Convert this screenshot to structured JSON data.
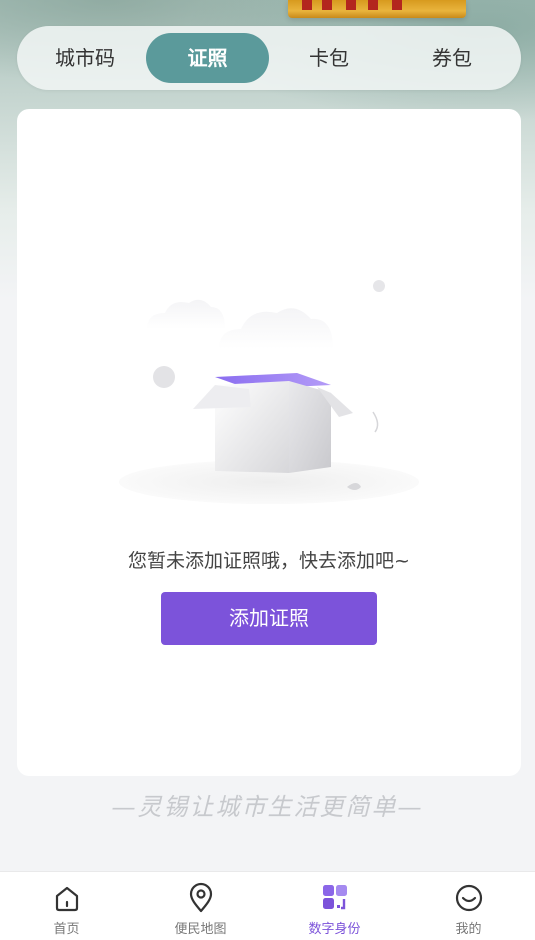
{
  "header": {
    "tabs": [
      {
        "label": "城市码"
      },
      {
        "label": "证照"
      },
      {
        "label": "卡包"
      },
      {
        "label": "券包"
      }
    ],
    "active_tab": "证照"
  },
  "empty_state": {
    "message": "您暂未添加证照哦，快去添加吧~",
    "button_label": "添加证照",
    "illustration_icon": "open-box-icon"
  },
  "slogan": "—灵锡让城市生活更简单—",
  "bottom_nav": {
    "items": [
      {
        "label": "首页",
        "icon": "home-icon"
      },
      {
        "label": "便民地图",
        "icon": "location-pin-icon"
      },
      {
        "label": "数字身份",
        "icon": "digital-id-icon"
      },
      {
        "label": "我的",
        "icon": "smile-icon"
      }
    ],
    "active": "数字身份"
  },
  "colors": {
    "accent": "#7c53da",
    "active_tab": "#5b9a9b",
    "nav_inactive": "#777777"
  }
}
